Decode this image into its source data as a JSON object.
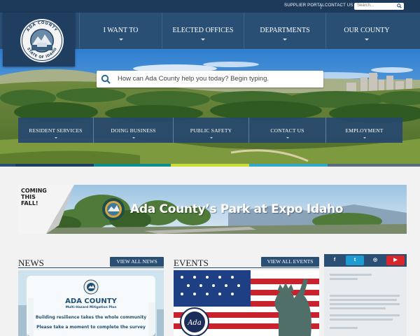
{
  "topbar": {
    "supplier_portal": "SUPPLIER PORTAL",
    "contact_us": "CONTACT US",
    "search_placeholder": "Search..."
  },
  "seal": {
    "top_text": "ADA COUNTY",
    "bottom_text": "STATE OF IDAHO"
  },
  "main_nav": [
    {
      "label": "I WANT TO"
    },
    {
      "label": "ELECTED OFFICES"
    },
    {
      "label": "DEPARTMENTS"
    },
    {
      "label": "OUR COUNTY"
    }
  ],
  "hero": {
    "search_placeholder": "How can Ada County help you today? Begin typing."
  },
  "sub_nav": [
    {
      "label": "RESIDENT SERVICES"
    },
    {
      "label": "DOING BUSINESS"
    },
    {
      "label": "PUBLIC SAFETY"
    },
    {
      "label": "CONTACT US"
    },
    {
      "label": "EMPLOYMENT"
    }
  ],
  "color_strip": [
    "#2a4f75",
    "#1f3f60",
    "#0f8d8d",
    "#c9dc35",
    "#31a7c9",
    "#5c6c7c"
  ],
  "banner": {
    "coming_1": "COMING",
    "coming_2": "THIS",
    "coming_3": "FALL!",
    "title": "Ada County’s Park at Expo Idaho"
  },
  "news": {
    "heading": "NEWS",
    "view_all": "VIEW ALL NEWS",
    "card_title": "ADA COUNTY",
    "card_subtitle": "Multi-Hazard Mitigation Plan",
    "card_line1": "Building resilience takes the whole community",
    "card_line2": "Please take a moment to complete the survey"
  },
  "events": {
    "heading": "EVENTS",
    "view_all": "VIEW ALL EVENTS",
    "badge_text": "Ada"
  },
  "social": [
    {
      "icon": "facebook-icon",
      "glyph": "f",
      "color": "#2a4f75"
    },
    {
      "icon": "twitter-icon",
      "glyph": "t",
      "color": "#1d9bd1"
    },
    {
      "icon": "instagram-icon",
      "glyph": "◎",
      "color": "#2a4f75"
    },
    {
      "icon": "youtube-icon",
      "glyph": "▶",
      "color": "#d8262b"
    }
  ],
  "colors": {
    "navy": "#2a4f75",
    "dark_navy": "#1e3a5a"
  }
}
